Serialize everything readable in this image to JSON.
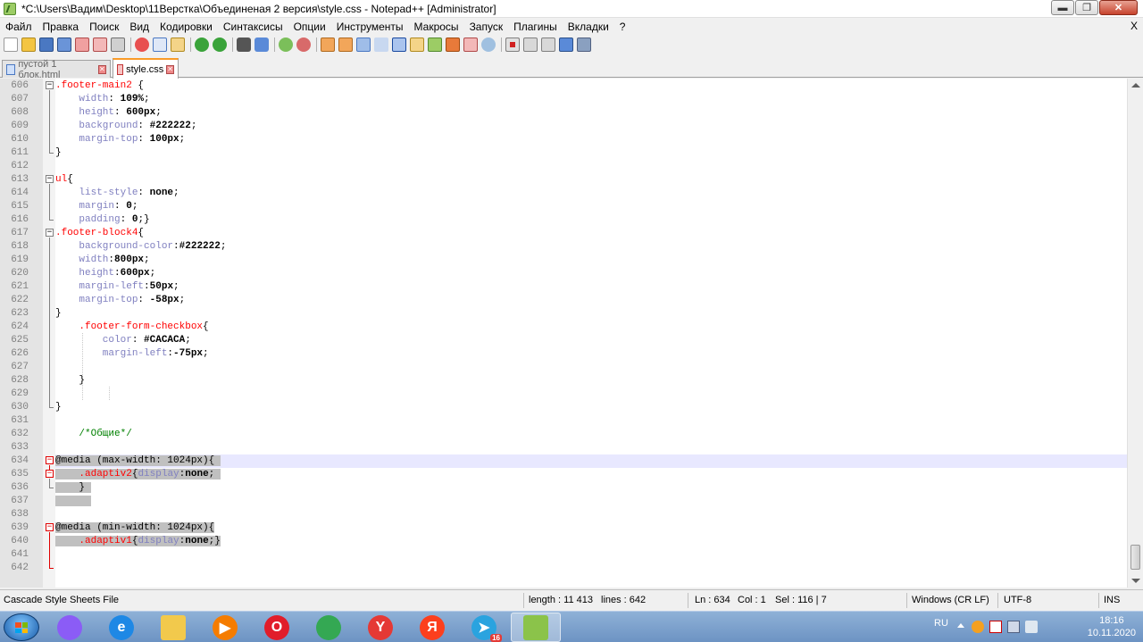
{
  "window": {
    "title": "*C:\\Users\\Вадим\\Desktop\\11Верстка\\Объединеная 2 версия\\style.css - Notepad++ [Administrator]",
    "controls": {
      "minimize": "▬",
      "maximize": "❐",
      "close": "✕"
    }
  },
  "menu": {
    "items": [
      "Файл",
      "Правка",
      "Поиск",
      "Вид",
      "Кодировки",
      "Синтаксисы",
      "Опции",
      "Инструменты",
      "Макросы",
      "Запуск",
      "Плагины",
      "Вкладки",
      "?"
    ],
    "close": "X"
  },
  "tabs": [
    {
      "label": "пустой 1 блок.html",
      "active": false
    },
    {
      "label": "style.css",
      "active": true
    }
  ],
  "editor": {
    "current_line": 634,
    "lines": [
      {
        "n": "606",
        "code": [
          {
            "t": ".footer-main2",
            "c": "c-sel"
          },
          {
            "t": " {",
            "c": "c-at"
          }
        ]
      },
      {
        "n": "607",
        "code": [
          {
            "t": "    width",
            "c": "c-prop"
          },
          {
            "t": ": ",
            "c": "c-at"
          },
          {
            "t": "109%",
            "c": "c-val"
          },
          {
            "t": ";",
            "c": "c-at"
          }
        ]
      },
      {
        "n": "608",
        "code": [
          {
            "t": "    height",
            "c": "c-prop"
          },
          {
            "t": ": ",
            "c": "c-at"
          },
          {
            "t": "600px",
            "c": "c-val"
          },
          {
            "t": ";",
            "c": "c-at"
          }
        ]
      },
      {
        "n": "609",
        "code": [
          {
            "t": "    background",
            "c": "c-prop"
          },
          {
            "t": ": ",
            "c": "c-at"
          },
          {
            "t": "#222222",
            "c": "c-val"
          },
          {
            "t": ";",
            "c": "c-at"
          }
        ]
      },
      {
        "n": "610",
        "code": [
          {
            "t": "    margin-top",
            "c": "c-prop"
          },
          {
            "t": ": ",
            "c": "c-at"
          },
          {
            "t": "100px",
            "c": "c-val"
          },
          {
            "t": ";",
            "c": "c-at"
          }
        ]
      },
      {
        "n": "611",
        "code": [
          {
            "t": "}",
            "c": "c-at"
          }
        ]
      },
      {
        "n": "612",
        "code": []
      },
      {
        "n": "613",
        "code": [
          {
            "t": "ul",
            "c": "c-sel"
          },
          {
            "t": "{",
            "c": "c-at"
          }
        ]
      },
      {
        "n": "614",
        "code": [
          {
            "t": "    list-style",
            "c": "c-prop"
          },
          {
            "t": ": ",
            "c": "c-at"
          },
          {
            "t": "none",
            "c": "c-val"
          },
          {
            "t": ";",
            "c": "c-at"
          }
        ]
      },
      {
        "n": "615",
        "code": [
          {
            "t": "    margin",
            "c": "c-prop"
          },
          {
            "t": ": ",
            "c": "c-at"
          },
          {
            "t": "0",
            "c": "c-val"
          },
          {
            "t": ";",
            "c": "c-at"
          }
        ]
      },
      {
        "n": "616",
        "code": [
          {
            "t": "    padding",
            "c": "c-prop"
          },
          {
            "t": ": ",
            "c": "c-at"
          },
          {
            "t": "0",
            "c": "c-val"
          },
          {
            "t": ";}",
            "c": "c-at"
          }
        ]
      },
      {
        "n": "617",
        "code": [
          {
            "t": ".footer-block4",
            "c": "c-sel"
          },
          {
            "t": "{",
            "c": "c-at"
          }
        ]
      },
      {
        "n": "618",
        "code": [
          {
            "t": "    background-color",
            "c": "c-prop"
          },
          {
            "t": ":",
            "c": "c-at"
          },
          {
            "t": "#222222",
            "c": "c-val"
          },
          {
            "t": ";",
            "c": "c-at"
          }
        ]
      },
      {
        "n": "619",
        "code": [
          {
            "t": "    width",
            "c": "c-prop"
          },
          {
            "t": ":",
            "c": "c-at"
          },
          {
            "t": "800px",
            "c": "c-val"
          },
          {
            "t": ";",
            "c": "c-at"
          }
        ]
      },
      {
        "n": "620",
        "code": [
          {
            "t": "    height",
            "c": "c-prop"
          },
          {
            "t": ":",
            "c": "c-at"
          },
          {
            "t": "600px",
            "c": "c-val"
          },
          {
            "t": ";",
            "c": "c-at"
          }
        ]
      },
      {
        "n": "621",
        "code": [
          {
            "t": "    margin-left",
            "c": "c-prop"
          },
          {
            "t": ":",
            "c": "c-at"
          },
          {
            "t": "50px",
            "c": "c-val"
          },
          {
            "t": ";",
            "c": "c-at"
          }
        ]
      },
      {
        "n": "622",
        "code": [
          {
            "t": "    margin-top",
            "c": "c-prop"
          },
          {
            "t": ": ",
            "c": "c-at"
          },
          {
            "t": "-58px",
            "c": "c-val"
          },
          {
            "t": ";",
            "c": "c-at"
          }
        ]
      },
      {
        "n": "623",
        "code": [
          {
            "t": "}",
            "c": "c-at"
          }
        ]
      },
      {
        "n": "624",
        "code": [
          {
            "t": "    .footer-form-checkbox",
            "c": "c-sel"
          },
          {
            "t": "{",
            "c": "c-at"
          }
        ]
      },
      {
        "n": "625",
        "code": [
          {
            "t": "        color",
            "c": "c-prop"
          },
          {
            "t": ": ",
            "c": "c-at"
          },
          {
            "t": "#CACACA",
            "c": "c-val"
          },
          {
            "t": ";",
            "c": "c-at"
          }
        ]
      },
      {
        "n": "626",
        "code": [
          {
            "t": "        margin-left",
            "c": "c-prop"
          },
          {
            "t": ":",
            "c": "c-at"
          },
          {
            "t": "-75px",
            "c": "c-val"
          },
          {
            "t": ";",
            "c": "c-at"
          }
        ]
      },
      {
        "n": "627",
        "code": []
      },
      {
        "n": "628",
        "code": [
          {
            "t": "    }",
            "c": "c-at"
          }
        ]
      },
      {
        "n": "629",
        "code": []
      },
      {
        "n": "630",
        "code": [
          {
            "t": "}",
            "c": "c-at"
          }
        ]
      },
      {
        "n": "631",
        "code": []
      },
      {
        "n": "632",
        "code": [
          {
            "t": "    /*Общие*/",
            "c": "c-com"
          }
        ]
      },
      {
        "n": "633",
        "code": []
      },
      {
        "n": "634",
        "code": [
          {
            "t": "@media (max-width: 1024px){ ",
            "c": "c-at sel"
          }
        ]
      },
      {
        "n": "635",
        "code": [
          {
            "t": "    ",
            "c": "c-at sel"
          },
          {
            "t": ".adaptiv2",
            "c": "c-sel sel"
          },
          {
            "t": "{",
            "c": "c-at sel"
          },
          {
            "t": "display",
            "c": "c-prop sel"
          },
          {
            "t": ":",
            "c": "c-at sel"
          },
          {
            "t": "none",
            "c": "c-val sel"
          },
          {
            "t": "; ",
            "c": "c-at sel"
          }
        ]
      },
      {
        "n": "636",
        "code": [
          {
            "t": "    } ",
            "c": "c-at sel"
          }
        ]
      },
      {
        "n": "637",
        "code": [
          {
            "t": "      ",
            "c": "c-at sel"
          }
        ]
      },
      {
        "n": "638",
        "code": []
      },
      {
        "n": "639",
        "code": [
          {
            "t": "@media (min-width: 1024px){",
            "c": "c-at sel"
          }
        ]
      },
      {
        "n": "640",
        "code": [
          {
            "t": "    ",
            "c": "c-at sel"
          },
          {
            "t": ".adaptiv1",
            "c": "c-sel sel"
          },
          {
            "t": "{",
            "c": "c-at sel"
          },
          {
            "t": "display",
            "c": "c-prop sel"
          },
          {
            "t": ":",
            "c": "c-at sel"
          },
          {
            "t": "none",
            "c": "c-val sel"
          },
          {
            "t": ";}",
            "c": "c-at sel"
          }
        ]
      },
      {
        "n": "641",
        "code": []
      },
      {
        "n": "642",
        "code": []
      }
    ]
  },
  "status": {
    "file_type": "Cascade Style Sheets File",
    "length": "length : 11 413",
    "lines": "lines : 642",
    "ln": "Ln : 634",
    "col": "Col : 1",
    "sel": "Sel : 116 | 7",
    "eol": "Windows (CR LF)",
    "encoding": "UTF-8",
    "mode": "INS"
  },
  "taskbar": {
    "apps": [
      {
        "name": "alice",
        "glyph": "",
        "color": "#8b5cf6"
      },
      {
        "name": "internet-explorer",
        "glyph": "e",
        "color": "#1e88e5"
      },
      {
        "name": "file-explorer",
        "glyph": "",
        "color": "#f2c94c"
      },
      {
        "name": "media-player",
        "glyph": "▶",
        "color": "#f57c00"
      },
      {
        "name": "opera",
        "glyph": "O",
        "color": "#e11d2a"
      },
      {
        "name": "chrome",
        "glyph": "",
        "color": "#34a853"
      },
      {
        "name": "yandex-browser",
        "glyph": "Y",
        "color": "#e53935"
      },
      {
        "name": "yandex",
        "glyph": "Я",
        "color": "#fc3f1d"
      },
      {
        "name": "telegram",
        "glyph": "➤",
        "color": "#2aa3df",
        "badge": "16"
      },
      {
        "name": "notepad-plus-plus",
        "glyph": "",
        "color": "#8bc34a",
        "active": true
      }
    ],
    "tray": {
      "lang": "RU",
      "time": "18:16",
      "date": "10.11.2020"
    }
  }
}
